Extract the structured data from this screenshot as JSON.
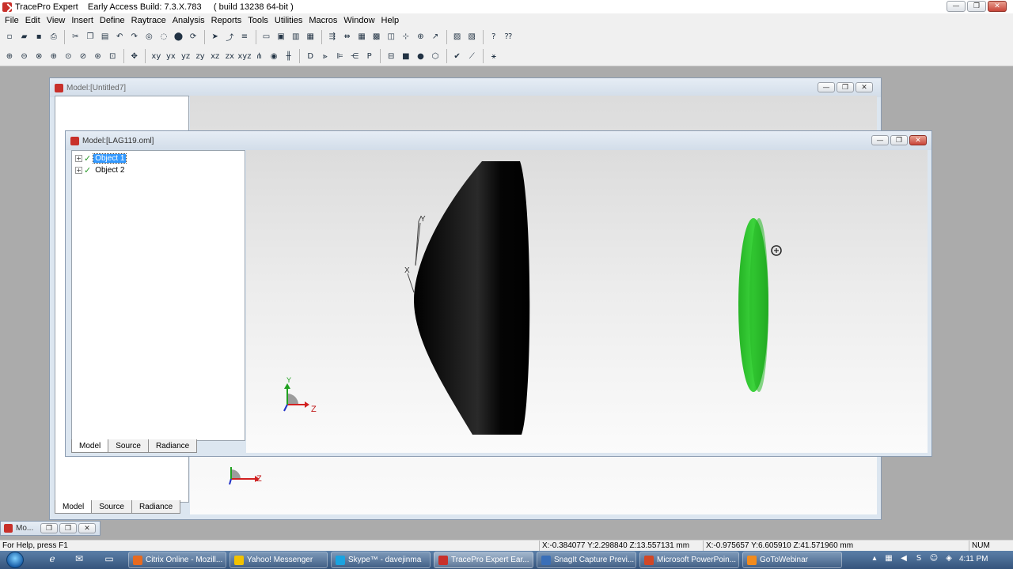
{
  "app": {
    "title": "TracePro Expert    Early Access Build: 7.3.X.783     ( build 13238 64-bit )"
  },
  "window_controls": {
    "minimize": "—",
    "restore": "❐",
    "close": "✕"
  },
  "menu": [
    "File",
    "Edit",
    "View",
    "Insert",
    "Define",
    "Raytrace",
    "Analysis",
    "Reports",
    "Tools",
    "Utilities",
    "Macros",
    "Window",
    "Help"
  ],
  "toolbar1": {
    "groups": [
      [
        "new-file-icon",
        "open-folder-icon",
        "save-icon",
        "print-icon"
      ],
      [
        "cut-icon",
        "copy-icon",
        "paste-icon",
        "undo-icon",
        "redo-icon",
        "eye-icon",
        "eye-dim-icon",
        "cylinder-icon",
        "refresh-icon"
      ],
      [
        "pointer-icon",
        "select-icon",
        "list-icon"
      ],
      [
        "window-icon",
        "cascade-icon",
        "split-horizontal-icon",
        "split-vertical-icon"
      ],
      [
        "raytrace-icon",
        "raytrace-options-icon",
        "grid-icon",
        "table-icon",
        "analysis-icon",
        "plot-icon",
        "target-icon",
        "chart-icon"
      ],
      [
        "irradiance-icon",
        "candela-icon"
      ],
      [
        "help-icon",
        "context-help-icon"
      ]
    ],
    "glyphs": [
      "▫",
      "▰",
      "▪",
      "⎙",
      "✂",
      "❐",
      "▤",
      "↶",
      "↷",
      "◎",
      "◌",
      "⬤",
      "⟳",
      "➤",
      "⤴",
      "≡",
      "▭",
      "▣",
      "▥",
      "▦",
      "⇶",
      "⇻",
      "▦",
      "▩",
      "◫",
      "⊹",
      "⊕",
      "↗",
      "▨",
      "▧",
      "?",
      "⁇"
    ]
  },
  "toolbar2": {
    "groups": [
      [
        "zoom-in-icon",
        "zoom-out-icon",
        "zoom-window-icon",
        "zoom-fit-icon",
        "zoom-all-icon",
        "zoom-selection-icon",
        "zoom-region-icon",
        "zoom-pan-icon"
      ],
      [
        "pan-icon"
      ],
      [
        "view-xy-icon",
        "view-yx-icon",
        "view-yz-icon",
        "view-zy-icon",
        "view-xz-icon",
        "view-zx-icon",
        "view-iso-icon",
        "view-axes-icon",
        "render-solid-icon",
        "render-wire-icon"
      ],
      [
        "mirror-icon",
        "flip-icon",
        "lens-icon",
        "slice-icon",
        "profile-icon"
      ],
      [
        "frame-icon",
        "stop-icon",
        "dot-icon",
        "shield-icon"
      ],
      [
        "check-icon",
        "ruler-icon"
      ],
      [
        "settings-icon"
      ]
    ],
    "glyphs": [
      "⊕",
      "⊖",
      "⊗",
      "⊕",
      "⊙",
      "⊘",
      "⊛",
      "⊡",
      "✥",
      "xy",
      "yx",
      "yz",
      "zy",
      "xz",
      "zx",
      "xyz",
      "⋔",
      "◉",
      "╫",
      "D",
      "⫸",
      "⊫",
      "⋲",
      "P",
      "⊟",
      "■",
      "●",
      "⬡",
      "✔",
      "⟋",
      "⚹"
    ]
  },
  "windows": {
    "back": {
      "title": "Model:[Untitled7]",
      "tabs": [
        "Model",
        "Source",
        "Radiance"
      ],
      "axis_label": "Z"
    },
    "front": {
      "title": "Model:[LAG119.oml]",
      "tree": [
        {
          "label": "Object 1",
          "selected": true
        },
        {
          "label": "Object 2",
          "selected": false
        }
      ],
      "tabs": [
        "Model",
        "Source",
        "Radiance"
      ],
      "axes": {
        "y": "Y",
        "x": "X",
        "z": "Z"
      },
      "local_axes": {
        "y": "Y",
        "x": "X"
      }
    },
    "minimized": {
      "title": "Mo..."
    }
  },
  "statusbar": {
    "help": "For Help, press F1",
    "coord1": "X:-0.384077 Y:2.298840 Z:13.557131 mm",
    "coord2": "X:-0.975657 Y:6.605910 Z:41.571960 mm",
    "num": "NUM"
  },
  "taskbar": {
    "buttons": [
      {
        "label": "Citrix Online - Mozill...",
        "color": "#e86a1f"
      },
      {
        "label": "Yahoo! Messenger",
        "color": "#f2c200"
      },
      {
        "label": "Skype™ - davejinma",
        "color": "#1aa3e0"
      },
      {
        "label": "TracePro Expert    Ear...",
        "color": "#c8302a",
        "active": true
      },
      {
        "label": "SnagIt Capture Previ...",
        "color": "#3a6fb8"
      },
      {
        "label": "Microsoft PowerPoin...",
        "color": "#d24726"
      },
      {
        "label": "GoToWebinar",
        "color": "#f28b1d"
      }
    ],
    "clock": "4:11 PM"
  },
  "colors": {
    "lens": "#000000",
    "disc": "#2ec22e",
    "selection": "#3399ff",
    "axis_x": "#d22020",
    "axis_y": "#20a020",
    "axis_z": "#2030c8"
  }
}
